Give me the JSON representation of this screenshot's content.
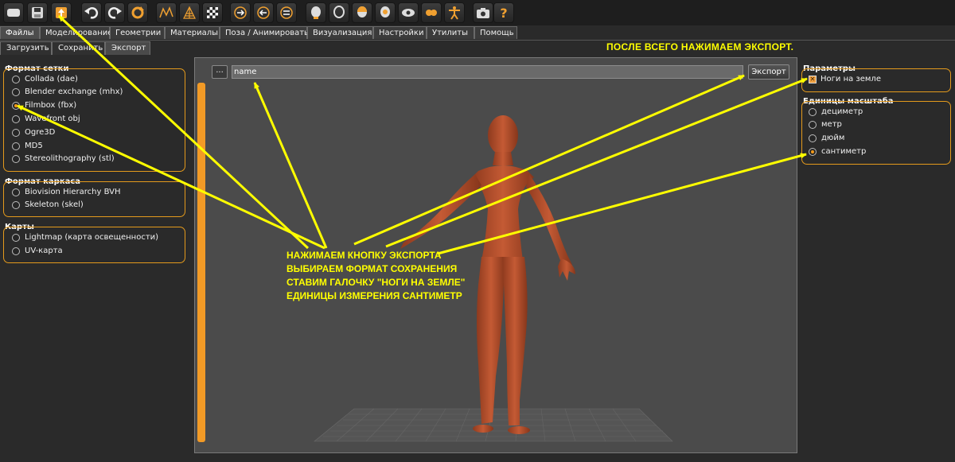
{
  "toolbar": {
    "buttons": [
      "new-icon",
      "save-icon",
      "export-icon",
      "undo-icon",
      "redo-icon",
      "reset-icon",
      "wireframe-icon",
      "smooth-icon",
      "grid-icon",
      "front-view-icon",
      "back-view-icon",
      "side-view-icon",
      "head-front-icon",
      "head-side-icon",
      "head-top-icon",
      "head-back-icon",
      "eyes-icon",
      "chest-icon",
      "pose-icon",
      "screenshot-icon",
      "help-icon"
    ]
  },
  "main_tabs": [
    "Файлы",
    "Моделирование",
    "Геометрии",
    "Материалы",
    "Поза / Анимировать",
    "Визуализация",
    "Настройки",
    "Утилиты",
    "Помощь"
  ],
  "sub_tabs": [
    "Загрузить",
    "Сохранить",
    "Экспорт"
  ],
  "notice": "ПОСЛЕ ВСЕГО НАЖИМАЕМ ЭКСПОРТ.",
  "mesh_format": {
    "title": "Формат сетки",
    "options": [
      "Collada (dae)",
      "Blender exchange (mhx)",
      "Filmbox (fbx)",
      "Wavefront obj",
      "Ogre3D",
      "MD5",
      "Stereolithography (stl)"
    ],
    "selected": "Filmbox (fbx)"
  },
  "skeleton_format": {
    "title": "Формат каркаса",
    "options": [
      "Biovision Hierarchy BVH",
      "Skeleton (skel)"
    ]
  },
  "maps": {
    "title": "Карты",
    "options": [
      "Lightmap (карта освещенности)",
      "UV-карта"
    ]
  },
  "file_bar": {
    "browse_label": "...",
    "filename": "name",
    "export_label": "Экспорт"
  },
  "parameters": {
    "title": "Параметры",
    "feet_on_ground_label": "Ноги на земле",
    "feet_on_ground_checked": true
  },
  "scale_units": {
    "title": "Единицы масштаба",
    "options": [
      "дециметр",
      "метр",
      "дюйм",
      "сантиметр"
    ],
    "selected": "сантиметр"
  },
  "instructions": [
    "НАЖИМАЕМ КНОПКУ ЭКСПОРТА",
    "ВЫБИРАЕМ ФОРМАТ СОХРАНЕНИЯ",
    "СТАВИМ ГАЛОЧКУ \"НОГИ НА ЗЕМЛЕ\"",
    "ЕДИНИЦЫ ИЗМЕРЕНИЯ САНТИМЕТР"
  ],
  "colors": {
    "accent": "#e49a1c",
    "annotation": "#ffff00",
    "skin": "#b8502e",
    "viewport": "#4b4b4b"
  }
}
